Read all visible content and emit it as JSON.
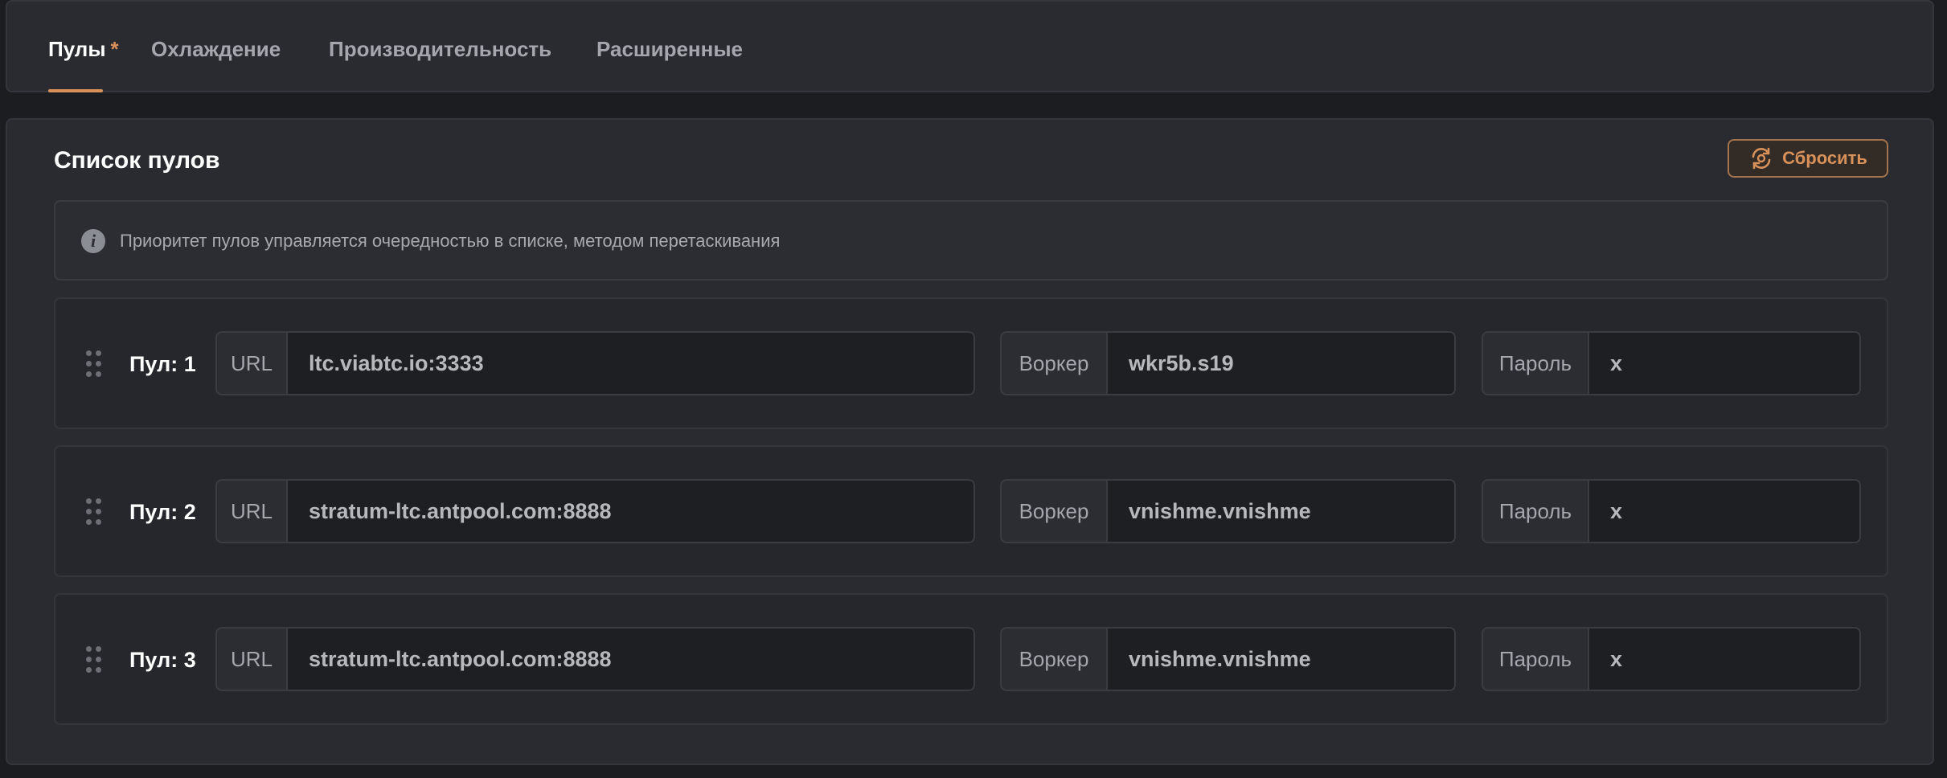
{
  "tabs": [
    {
      "label": "Пулы",
      "active": true,
      "modified_marker": "*"
    },
    {
      "label": "Охлаждение",
      "active": false
    },
    {
      "label": "Производительность",
      "active": false
    },
    {
      "label": "Расширенные",
      "active": false
    }
  ],
  "section": {
    "title": "Список пулов",
    "reset_label": "Сбросить",
    "info_text": "Приоритет пулов управляется очередностью в списке, методом перетаскивания"
  },
  "field_labels": {
    "url": "URL",
    "worker": "Воркер",
    "password": "Пароль"
  },
  "pools": [
    {
      "label": "Пул: 1",
      "url": "ltc.viabtc.io:3333",
      "worker": "wkr5b.s19",
      "password": "x"
    },
    {
      "label": "Пул: 2",
      "url": "stratum-ltc.antpool.com:8888",
      "worker": "vnishme.vnishme",
      "password": "x"
    },
    {
      "label": "Пул: 3",
      "url": "stratum-ltc.antpool.com:8888",
      "worker": "vnishme.vnishme",
      "password": "x"
    }
  ],
  "colors": {
    "accent": "#d9915a",
    "background": "#1c1d20",
    "card": "#292b31"
  },
  "icons": {
    "reset": "reset-cycle-icon",
    "info": "info-icon",
    "drag": "drag-handle-icon"
  }
}
